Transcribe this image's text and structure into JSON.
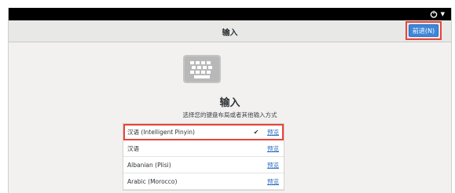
{
  "topbar": {
    "menu_icons": [
      "power-icon",
      "caret-down-icon"
    ]
  },
  "header": {
    "title": "输入",
    "next_label": "前进(N)"
  },
  "page": {
    "icon": "keyboard-icon",
    "title": "输入",
    "subtitle": "选择您的键盘布局或者其他输入方式"
  },
  "list": {
    "items": [
      {
        "label": "汉语 (Intelligent Pinyin)",
        "selected": true,
        "preview_label": "预览"
      },
      {
        "label": "汉语",
        "selected": false,
        "preview_label": "预览"
      },
      {
        "label": "Albanian (Plisi)",
        "selected": false,
        "preview_label": "预览"
      },
      {
        "label": "Arabic (Morocco)",
        "selected": false,
        "preview_label": "预览"
      }
    ]
  },
  "colors": {
    "accent": "#3f86d8",
    "highlight": "#e8443a",
    "background": "#f2f1f0"
  }
}
